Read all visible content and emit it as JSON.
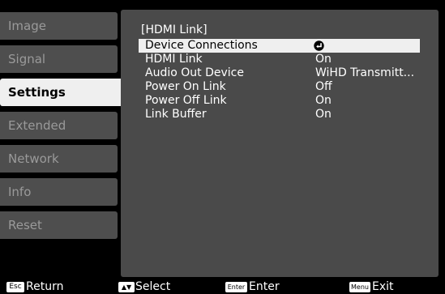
{
  "sidebar": {
    "items": [
      {
        "label": "Image"
      },
      {
        "label": "Signal"
      },
      {
        "label": "Settings"
      },
      {
        "label": "Extended"
      },
      {
        "label": "Network"
      },
      {
        "label": "Info"
      },
      {
        "label": "Reset"
      }
    ],
    "active_index": 2
  },
  "panel": {
    "title": "[HDMI Link]",
    "rows": [
      {
        "label": "Device Connections",
        "value": "",
        "icon": "enter-icon"
      },
      {
        "label": "HDMI Link",
        "value": "On"
      },
      {
        "label": "Audio Out Device",
        "value": "WiHD Transmitt..."
      },
      {
        "label": "Power On Link",
        "value": "Off"
      },
      {
        "label": "Power Off Link",
        "value": "On"
      },
      {
        "label": "Link Buffer",
        "value": "On"
      }
    ],
    "selected_index": 0
  },
  "footer": {
    "items": [
      {
        "key": "Esc",
        "label": "Return"
      },
      {
        "key": "▲▼",
        "label": "Select"
      },
      {
        "key": "Enter",
        "label": "Enter"
      },
      {
        "key": "Menu",
        "label": "Exit"
      }
    ]
  },
  "colors": {
    "background": "#000000",
    "panel": "#4a4a4a",
    "sidebar_item": "#4e4e4e",
    "highlight": "#efefef",
    "text": "#ffffff",
    "muted_text": "#9a9a9a"
  }
}
